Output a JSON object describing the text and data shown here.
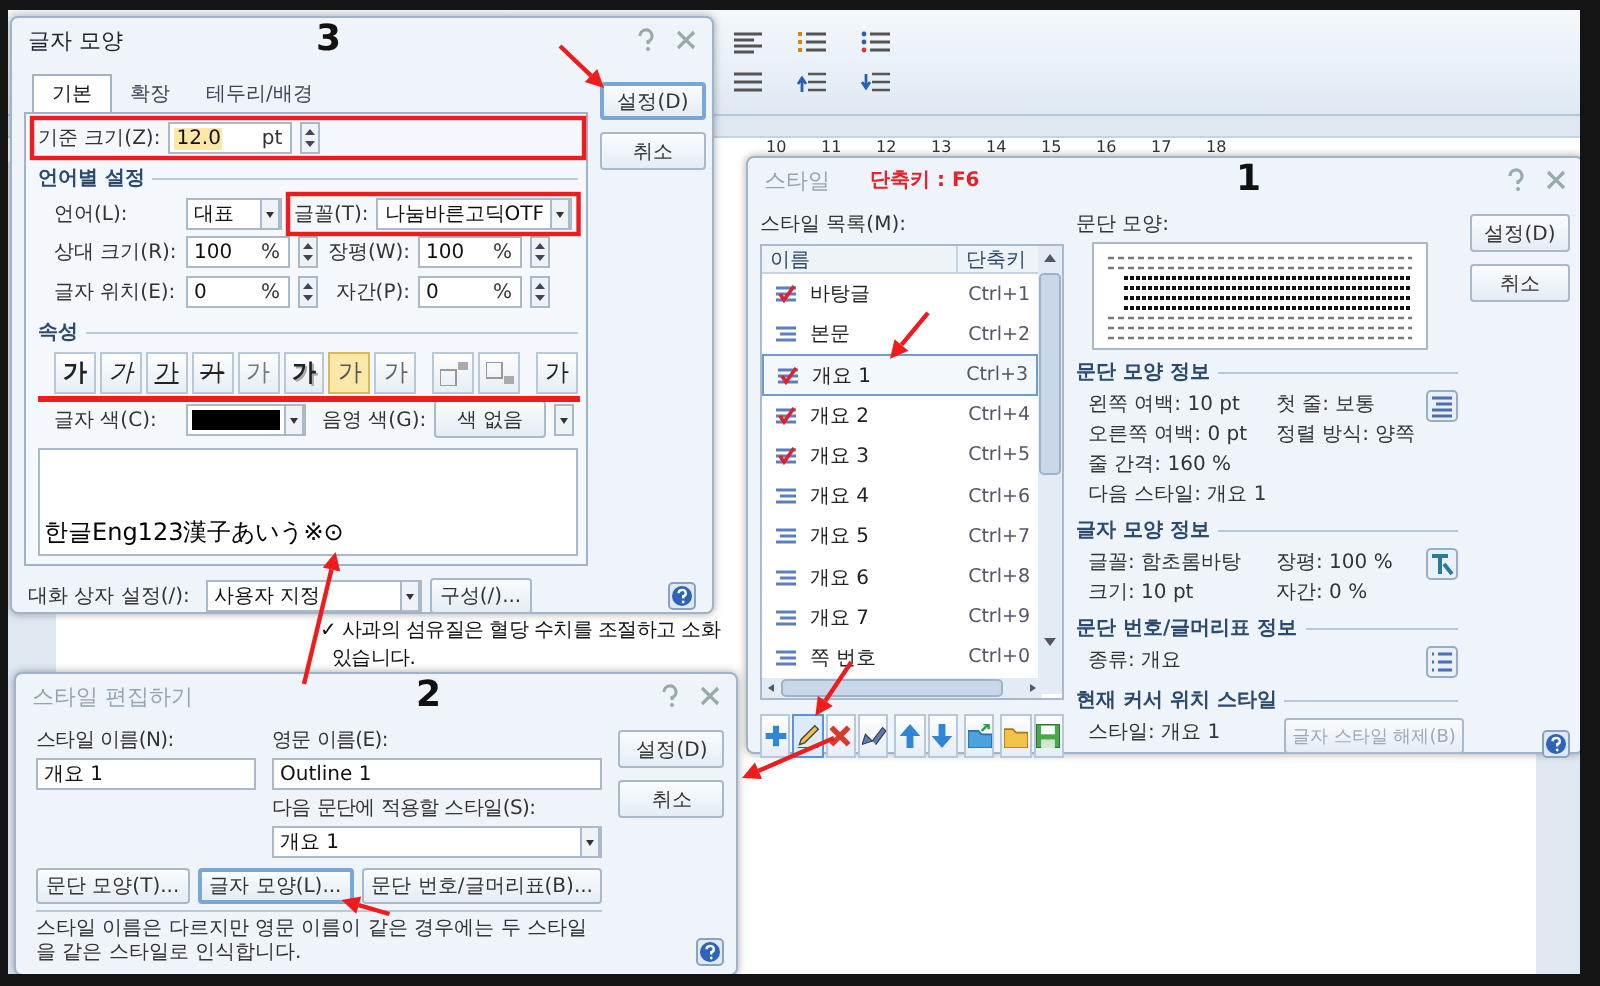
{
  "ruler": {
    "ticks": [
      "10",
      "11",
      "12",
      "13",
      "14",
      "15",
      "16",
      "17",
      "18"
    ]
  },
  "document": {
    "lines": [
      "✓ 사과의 섬유질은 혈당 수치를 조절하고 소화",
      "있습니다."
    ]
  },
  "char_shape_dialog": {
    "title": "글자 모양",
    "active": true,
    "callout": "3",
    "tabs": [
      {
        "label": "기본",
        "selected": true
      },
      {
        "label": "확장",
        "selected": false
      },
      {
        "label": "테두리/배경",
        "selected": false
      }
    ],
    "buttons": [
      {
        "label": "설정(D)",
        "focused": true
      },
      {
        "label": "취소",
        "focused": false
      }
    ],
    "base_size": {
      "label": "기준 크기(Z):",
      "value": "12.0",
      "unit": "pt"
    },
    "language_section": "언어별 설정",
    "language": {
      "label": "언어(L):",
      "value": "대표"
    },
    "font": {
      "label": "글꼴(T):",
      "value": "나눔바른고딕OTF"
    },
    "spin_fields": [
      {
        "label": "상대 크기(R):",
        "value": "100",
        "unit": "%"
      },
      {
        "label": "장평(W):",
        "value": "100",
        "unit": "%"
      },
      {
        "label": "글자 위치(E):",
        "value": "0",
        "unit": "%"
      },
      {
        "label": "자간(P):",
        "value": "0",
        "unit": "%"
      }
    ],
    "attributes_section": "속성",
    "attributes": [
      {
        "kind": "bold",
        "text": "가",
        "selected": false
      },
      {
        "kind": "italic",
        "text": "가",
        "selected": false
      },
      {
        "kind": "underline",
        "text": "가",
        "selected": false
      },
      {
        "kind": "strike",
        "text": "가",
        "selected": false
      },
      {
        "kind": "outline",
        "text": "가",
        "selected": false
      },
      {
        "kind": "shadow",
        "text": "가",
        "selected": false
      },
      {
        "kind": "emboss",
        "text": "가",
        "selected": true
      },
      {
        "kind": "engrave",
        "text": "가",
        "selected": false
      },
      {
        "kind": "superscript",
        "selected": false
      },
      {
        "kind": "subscript",
        "selected": false
      },
      {
        "kind": "normal",
        "text": "가",
        "selected": false
      }
    ],
    "text_color": {
      "label": "글자 색(C):",
      "color": "#000000"
    },
    "shade_color": {
      "label": "음영 색(G):",
      "value": "색 없음"
    },
    "preview_text": "한글Eng123漢子あいう※⊙",
    "dialog_setting": {
      "label": "대화 상자 설정(/):",
      "value": "사용자 지정"
    },
    "compose_button": "구성(/)..."
  },
  "style_dialog": {
    "title": "스타일",
    "active": false,
    "hotkey_note": "단축키 : F6",
    "callout": "1",
    "list_label": "스타일 목록(M):",
    "columns": [
      "이름",
      "단축키"
    ],
    "rows": [
      {
        "kind": "checked",
        "name": "바탕글",
        "shortcut": "Ctrl+1",
        "selected": false
      },
      {
        "kind": "plain",
        "name": "본문",
        "shortcut": "Ctrl+2",
        "selected": false
      },
      {
        "kind": "checked",
        "name": "개요 1",
        "shortcut": "Ctrl+3",
        "selected": true
      },
      {
        "kind": "checked",
        "name": "개요 2",
        "shortcut": "Ctrl+4",
        "selected": false
      },
      {
        "kind": "checked",
        "name": "개요 3",
        "shortcut": "Ctrl+5",
        "selected": false
      },
      {
        "kind": "plain",
        "name": "개요 4",
        "shortcut": "Ctrl+6",
        "selected": false
      },
      {
        "kind": "plain",
        "name": "개요 5",
        "shortcut": "Ctrl+7",
        "selected": false
      },
      {
        "kind": "plain",
        "name": "개요 6",
        "shortcut": "Ctrl+8",
        "selected": false
      },
      {
        "kind": "plain",
        "name": "개요 7",
        "shortcut": "Ctrl+9",
        "selected": false
      },
      {
        "kind": "plain",
        "name": "쪽 번호",
        "shortcut": "Ctrl+0",
        "selected": false
      }
    ],
    "preview_label": "문단 모양:",
    "info_sections": [
      {
        "title": "문단 모양 정보",
        "rows": [
          [
            "왼쪽 여백:  10 pt",
            "첫 줄: 보통"
          ],
          [
            "오른쪽 여백: 0 pt",
            "정렬 방식: 양쪽"
          ],
          [
            "줄 간격: 160 %"
          ],
          [
            "다음 스타일: 개요 1"
          ]
        ]
      },
      {
        "title": "글자 모양 정보",
        "rows": [
          [
            "글꼴: 함초롬바탕",
            "장평: 100 %"
          ],
          [
            "크기: 10 pt",
            "자간: 0 %"
          ]
        ]
      },
      {
        "title": "문단 번호/글머리표 정보",
        "rows": [
          [
            "종류: 개요"
          ]
        ]
      },
      {
        "title": "현재 커서 위치 스타일",
        "rows": [
          [
            "스타일: 개요 1"
          ]
        ],
        "button": {
          "label": "글자 스타일 해제(B)",
          "disabled": true
        }
      }
    ],
    "buttons": [
      "설정(D)",
      "취소"
    ],
    "toolbar": [
      {
        "kind": "add",
        "selected": false
      },
      {
        "kind": "edit",
        "selected": true
      },
      {
        "kind": "delete",
        "selected": false
      },
      {
        "kind": "rename",
        "selected": false
      },
      {
        "kind": "up",
        "selected": false
      },
      {
        "kind": "down",
        "selected": false
      },
      {
        "kind": "export",
        "selected": false
      },
      {
        "kind": "open",
        "selected": false
      },
      {
        "kind": "save",
        "selected": false
      }
    ]
  },
  "edit_style_dialog": {
    "title": "스타일 편집하기",
    "active": false,
    "callout": "2",
    "style_name": {
      "label": "스타일 이름(N):",
      "value": "개요 1"
    },
    "english_name": {
      "label": "영문 이름(E):",
      "value": "Outline 1"
    },
    "next_style": {
      "label": "다음 문단에 적용할 스타일(S):",
      "value": "개요 1"
    },
    "buttons": [
      {
        "label": "문단 모양(T)...",
        "focused": false
      },
      {
        "label": "글자 모양(L)...",
        "focused": true
      },
      {
        "label": "문단 번호/글머리표(B)...",
        "focused": false
      }
    ],
    "side_buttons": [
      "설정(D)",
      "취소"
    ],
    "note": "스타일 이름은 다르지만 영문 이름이 같은 경우에는 두 스타일을 같은 스타일로 인식합니다."
  }
}
